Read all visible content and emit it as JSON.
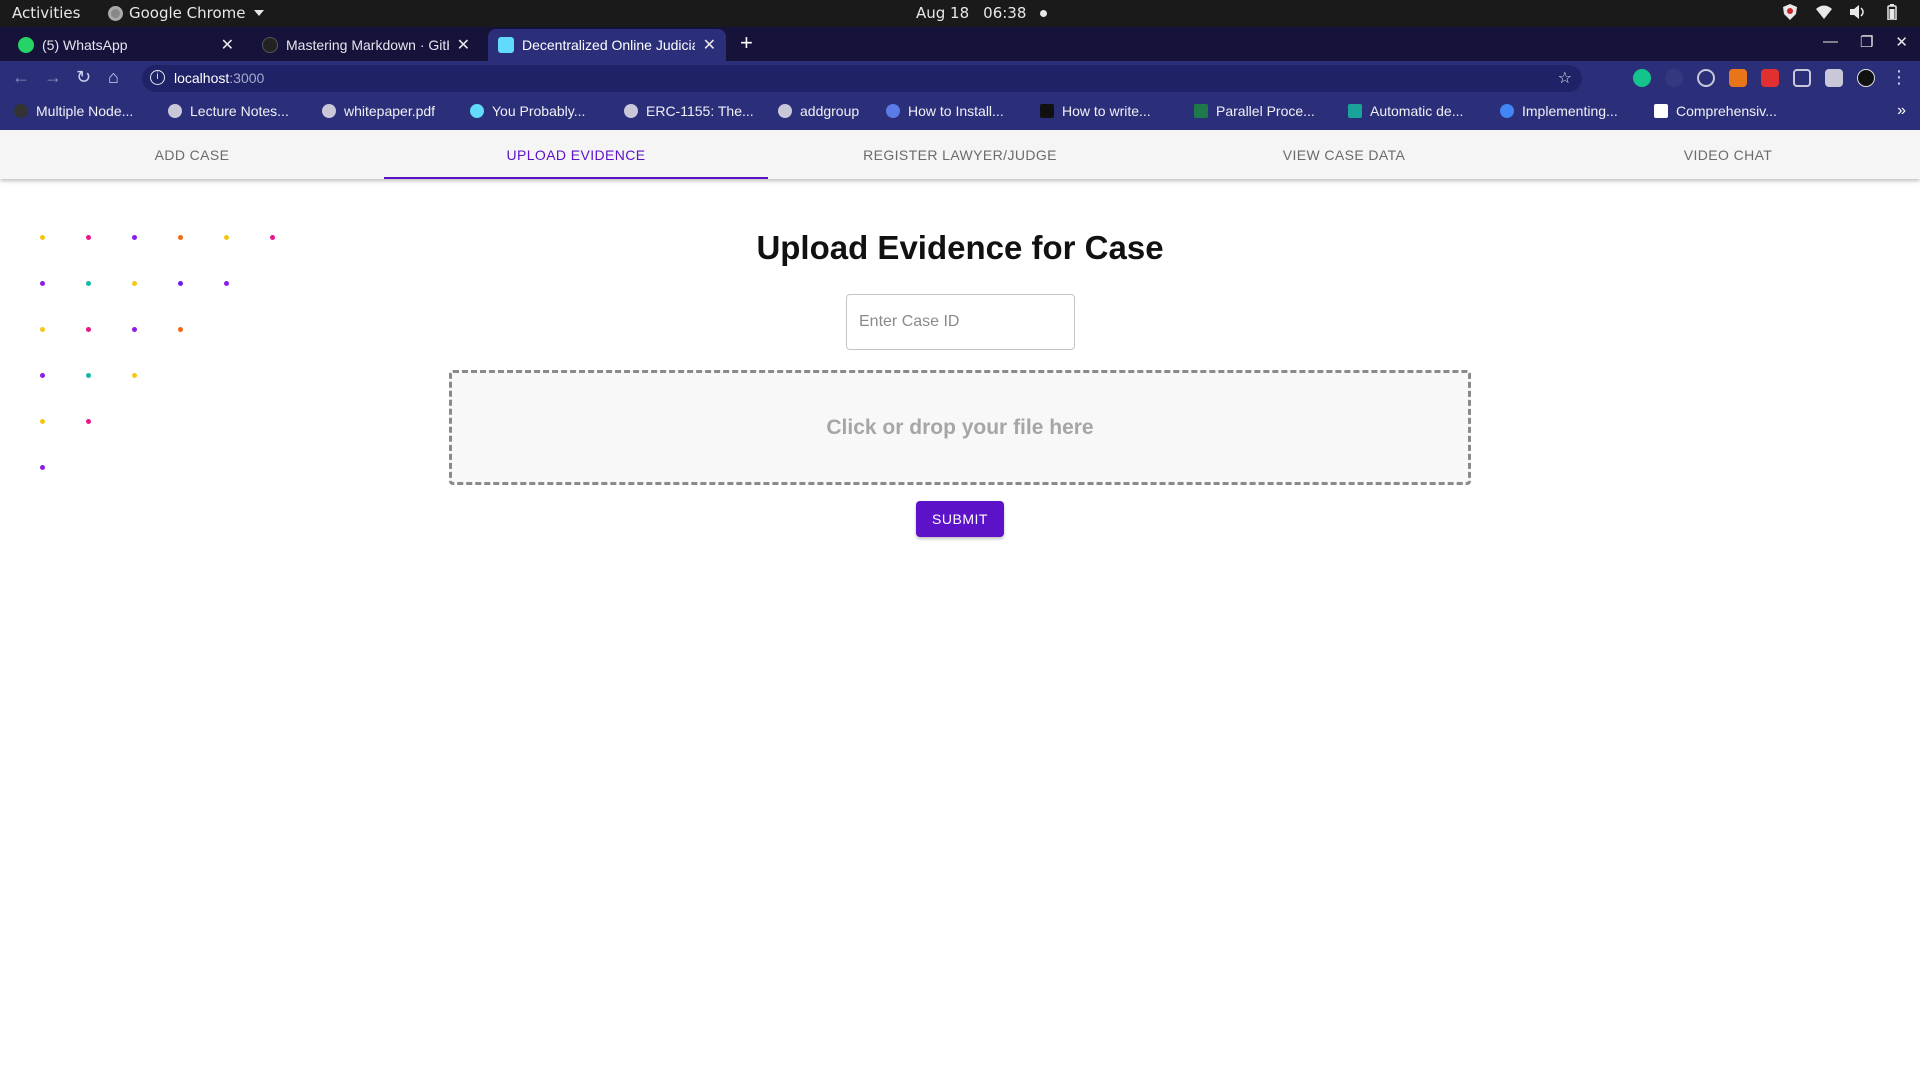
{
  "os_bar": {
    "activities": "Activities",
    "app_name": "Google Chrome",
    "date": "Aug 18",
    "time": "06:38"
  },
  "browser": {
    "tabs": [
      {
        "title": "(5) WhatsApp",
        "favicon": "whatsapp-icon",
        "favicon_color": "#25d366"
      },
      {
        "title": "Mastering Markdown · GitHub",
        "favicon": "github-icon",
        "favicon_color": "#222222"
      },
      {
        "title": "Decentralized Online Judiciary",
        "favicon": "react-icon",
        "favicon_color": "#61dafb"
      }
    ],
    "url_host": "localhost",
    "url_port": ":3000",
    "bookmarks": [
      {
        "label": "Multiple Node..."
      },
      {
        "label": "Lecture Notes..."
      },
      {
        "label": "whitepaper.pdf"
      },
      {
        "label": "You Probably..."
      },
      {
        "label": "ERC-1155: The..."
      },
      {
        "label": "addgroup"
      },
      {
        "label": "How to Install..."
      },
      {
        "label": "How to write..."
      },
      {
        "label": "Parallel Proce..."
      },
      {
        "label": "Automatic de..."
      },
      {
        "label": "Implementing..."
      },
      {
        "label": "Comprehensiv..."
      }
    ],
    "extension_colors": [
      "#14c48b",
      "#2b2f7a",
      "#b8b8c8",
      "#e8751a",
      "#e03030",
      "#c8c8d8",
      "#c8c8d8"
    ]
  },
  "app_nav": {
    "tabs": [
      {
        "label": "ADD CASE",
        "active": false
      },
      {
        "label": "UPLOAD EVIDENCE",
        "active": true
      },
      {
        "label": "REGISTER LAWYER/JUDGE",
        "active": false
      },
      {
        "label": "VIEW CASE DATA",
        "active": false
      },
      {
        "label": "VIDEO CHAT",
        "active": false
      }
    ]
  },
  "upload": {
    "heading": "Upload Evidence for Case",
    "case_id_placeholder": "Enter Case ID",
    "case_id_value": "",
    "dropzone_text": "Click or drop your file here",
    "submit_label": "SUBMIT"
  },
  "colors": {
    "accent": "#5b12c8",
    "dot_palette": [
      "#f5c518",
      "#e6178a",
      "#8a1ee8",
      "#f06a14",
      "#14b8a6",
      "#6a1ee8"
    ]
  }
}
